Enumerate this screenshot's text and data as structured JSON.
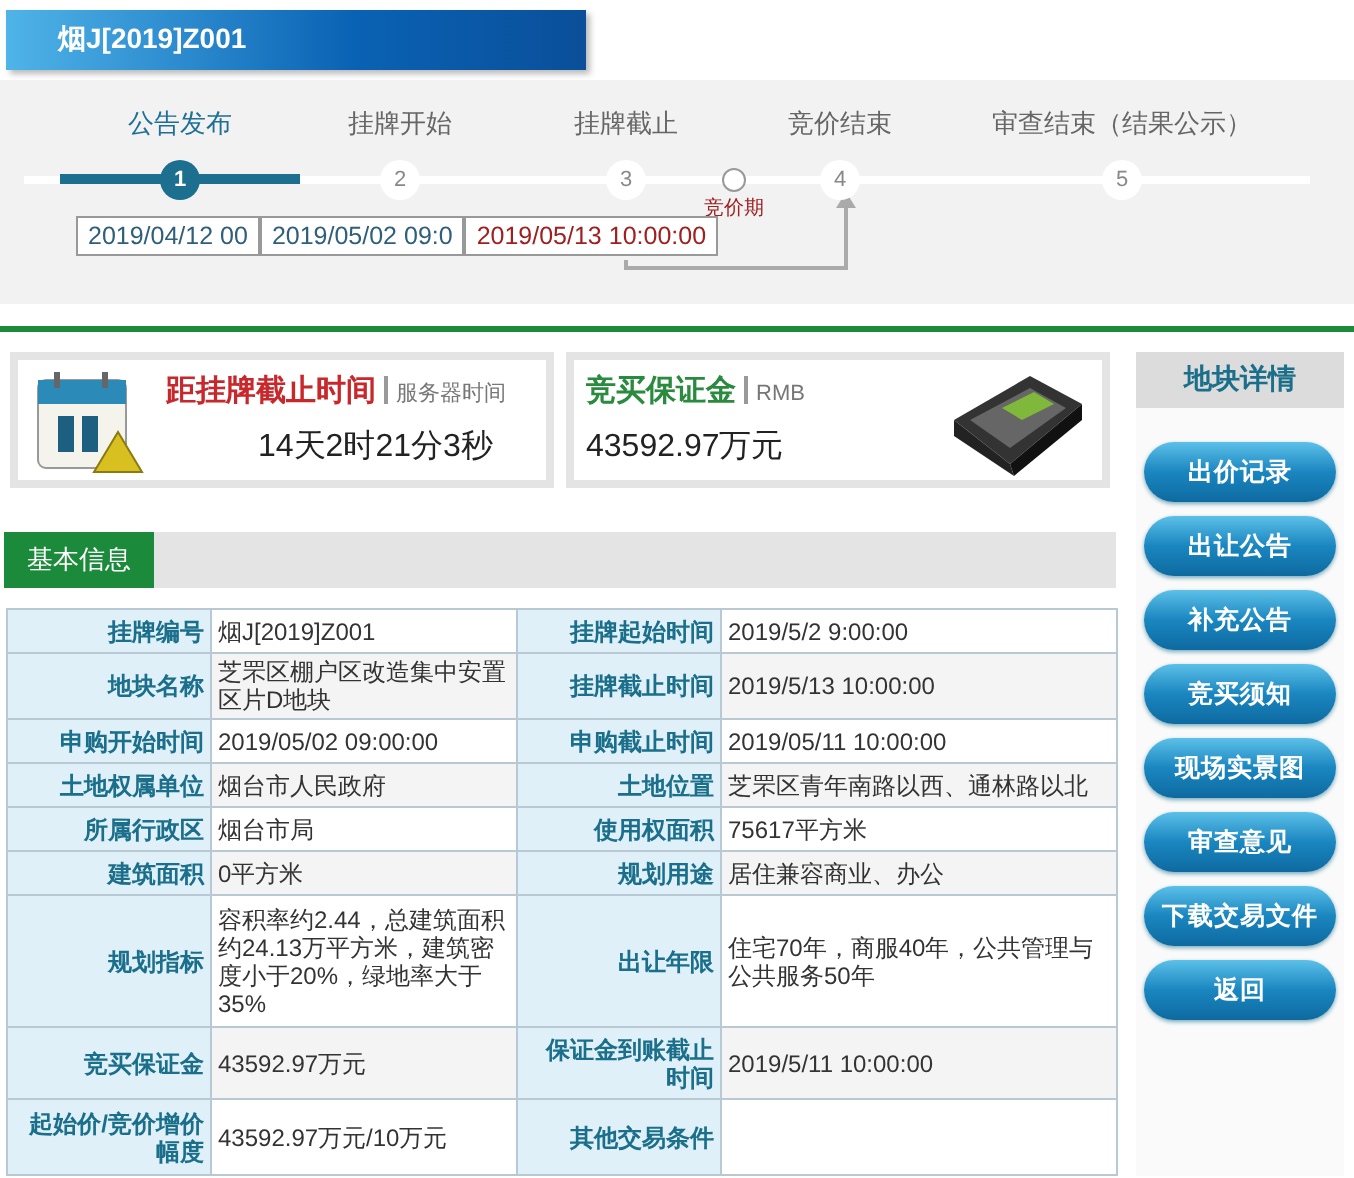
{
  "window": {
    "title": "烟J[2019]Z001"
  },
  "steps": [
    {
      "label": "公告发布",
      "number": "1",
      "selected": true
    },
    {
      "label": "挂牌开始",
      "number": "2",
      "selected": false
    },
    {
      "label": "挂牌截止",
      "number": "3",
      "selected": false
    },
    {
      "label": "竞价结束",
      "number": "4",
      "selected": false
    },
    {
      "label": "审查结束（结果公示）",
      "number": "5",
      "selected": false
    }
  ],
  "phase_marker": "竞价期",
  "dates": [
    {
      "text": "2019/04/12 00",
      "kind": "normal"
    },
    {
      "text": "2019/05/02 09:0",
      "kind": "normal"
    },
    {
      "text": "2019/05/13 10:00:00",
      "kind": "deadline"
    }
  ],
  "countdown": {
    "title": "距挂牌截止时间",
    "note": "服务器时间",
    "value": "14天2时21分3秒"
  },
  "deposit": {
    "title": "竞买保证金",
    "note": "RMB",
    "value": "43592.97万元"
  },
  "tabs": [
    {
      "label": "基本信息",
      "selected": true
    }
  ],
  "table": {
    "rows": [
      [
        "挂牌编号",
        "烟J[2019]Z001",
        "挂牌起始时间",
        "2019/5/2 9:00:00"
      ],
      [
        "地块名称",
        "芝罘区棚户区改造集中安置区片D地块",
        "挂牌截止时间",
        "2019/5/13 10:00:00"
      ],
      [
        "申购开始时间",
        "2019/05/02 09:00:00",
        "申购截止时间",
        "2019/05/11 10:00:00"
      ],
      [
        "土地权属单位",
        "烟台市人民政府",
        "土地位置",
        "芝罘区青年南路以西、通林路以北"
      ],
      [
        "所属行政区",
        "烟台市局",
        "使用权面积",
        "75617平方米"
      ],
      [
        "建筑面积",
        "0平方米",
        "规划用途",
        "居住兼容商业、办公"
      ],
      [
        "规划指标",
        "容积率约2.44，总建筑面积约24.13万平方米，建筑密度小于20%，绿地率大于35%",
        "出让年限",
        "住宅70年，商服40年，公共管理与公共服务50年"
      ],
      [
        "竞买保证金",
        "43592.97万元",
        "保证金到账截止时间",
        "2019/5/11 10:00:00"
      ],
      [
        "起始价/竞价增价幅度",
        "43592.97万元/10万元",
        "其他交易条件",
        ""
      ]
    ]
  },
  "sidebar": {
    "title": "地块详情",
    "buttons": [
      "出价记录",
      "出让公告",
      "补充公告",
      "竞买须知",
      "现场实景图",
      "审查意见",
      "下载交易文件",
      "返回"
    ]
  }
}
